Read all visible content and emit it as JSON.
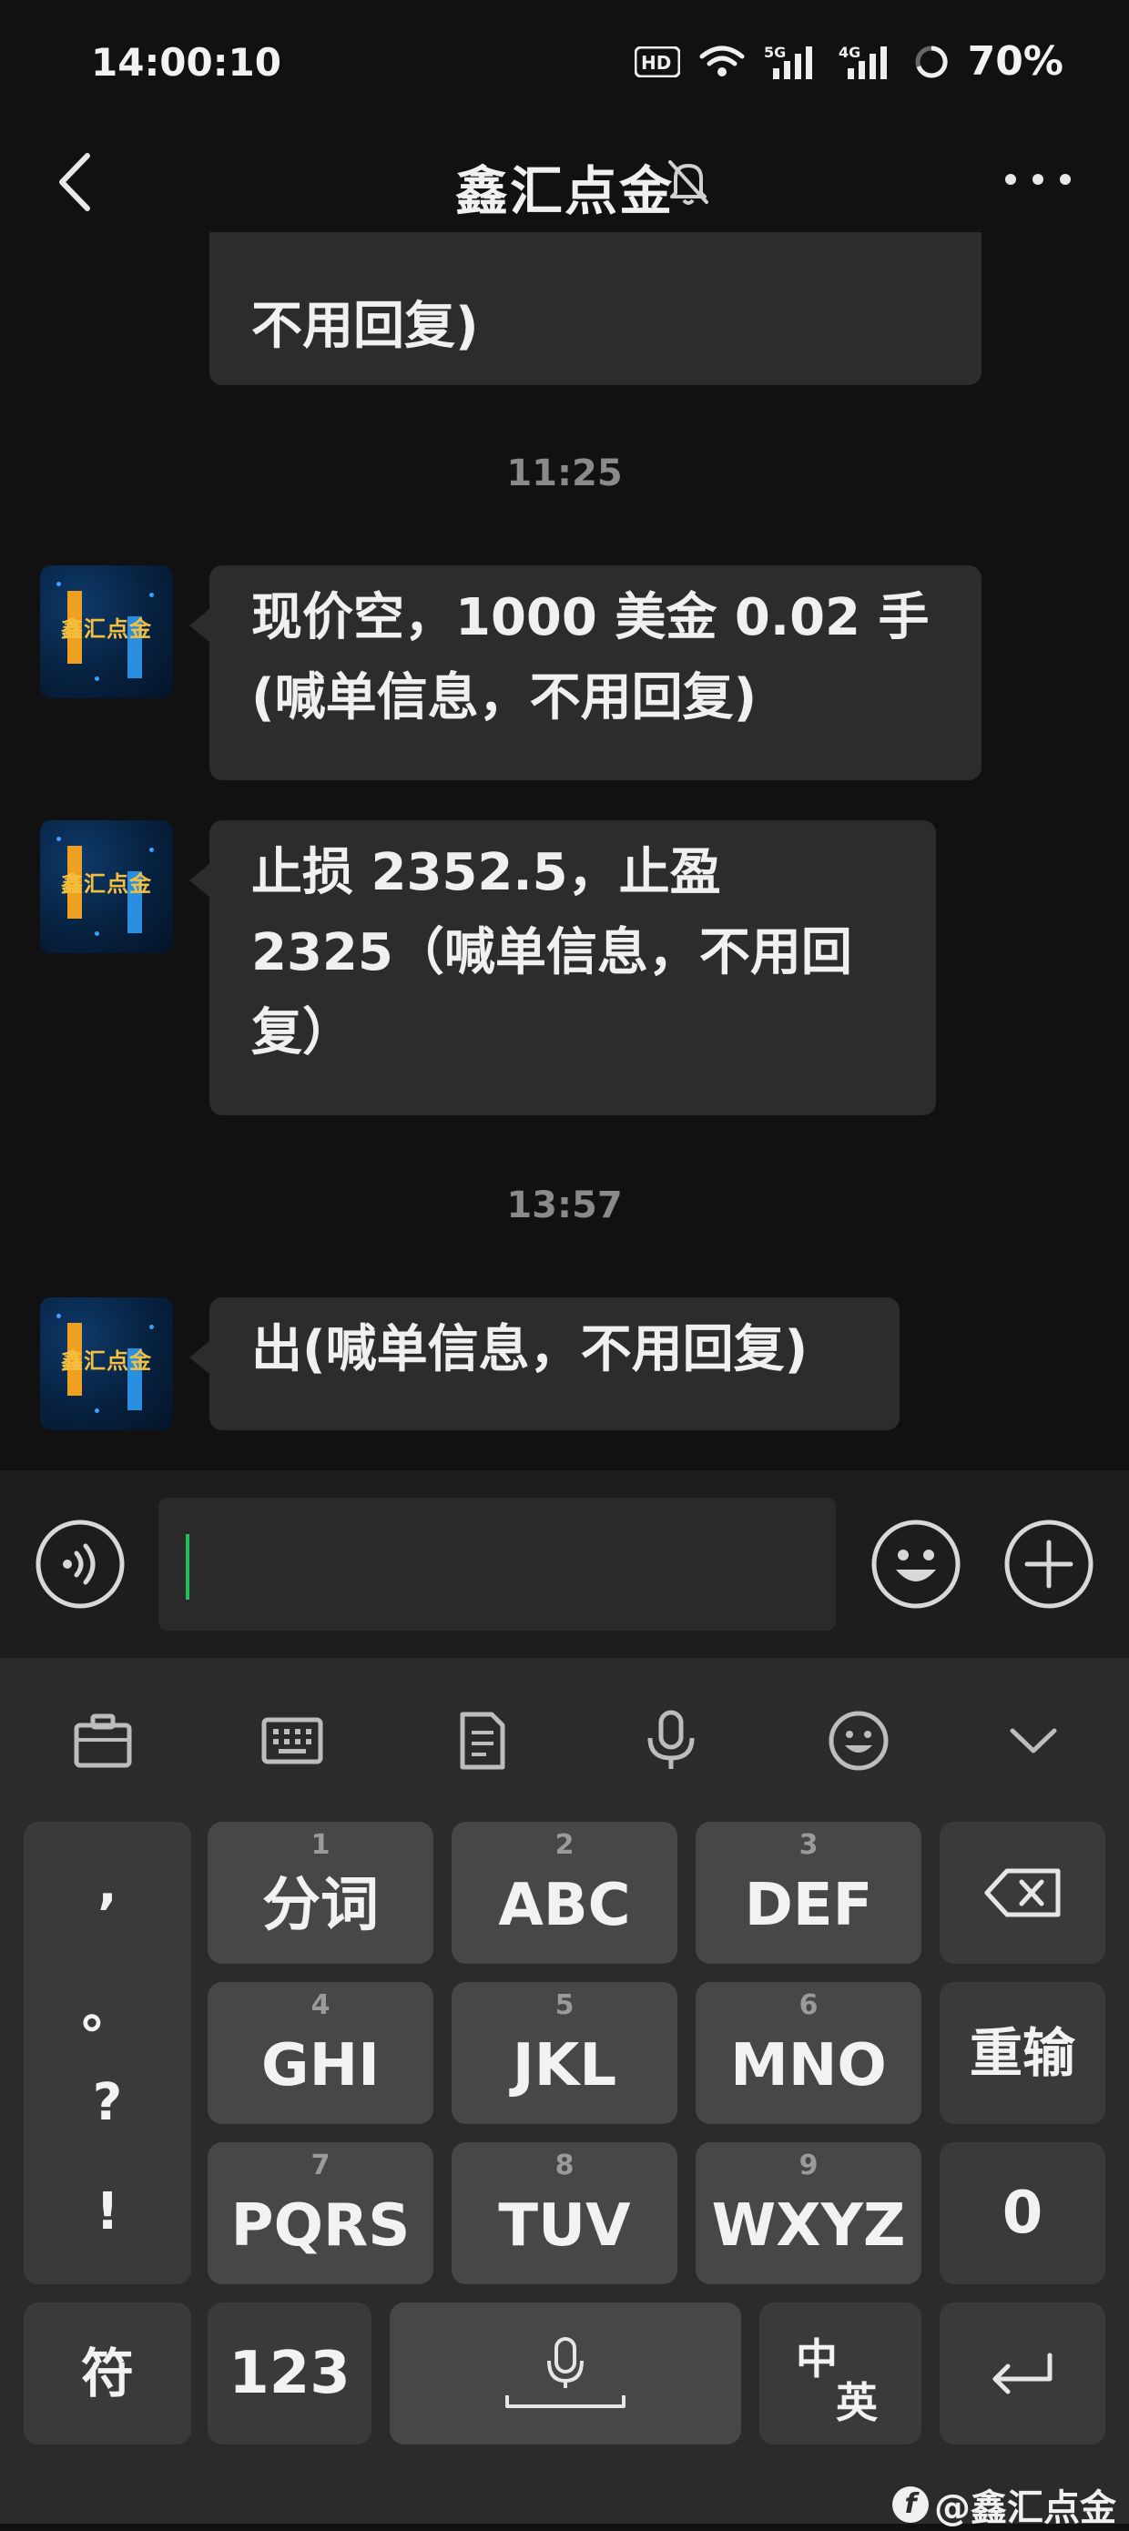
{
  "status_bar": {
    "time": "14:00:10",
    "network_icons": [
      "hd-icon",
      "wifi-icon",
      "5g-signal-icon",
      "4g-signal-icon"
    ],
    "net_labels": {
      "hd": "HD",
      "g5": "5G",
      "g4": "4G"
    },
    "battery": "70%"
  },
  "header": {
    "title": "鑫汇点金",
    "muted": true
  },
  "chat": {
    "messages": [
      {
        "text": "不用回复)"
      },
      {
        "timestamp": "11:25"
      },
      {
        "line1": "现价空，1000 美金 0.02 手",
        "line2": "(喊单信息，不用回复)"
      },
      {
        "line1": "止损 2352.5，止盈",
        "line2": "2325（喊单信息，不用回",
        "line3": "复）"
      },
      {
        "timestamp": "13:57"
      },
      {
        "text": "出(喊单信息，不用回复)"
      }
    ],
    "avatar_text": "鑫汇点金"
  },
  "input": {
    "value": ""
  },
  "keyboard": {
    "punct": [
      ",",
      "。",
      "?",
      "!"
    ],
    "keys": [
      {
        "num": "1",
        "label": "分词"
      },
      {
        "num": "2",
        "label": "ABC"
      },
      {
        "num": "3",
        "label": "DEF"
      },
      {
        "num": "4",
        "label": "GHI"
      },
      {
        "num": "5",
        "label": "JKL"
      },
      {
        "num": "6",
        "label": "MNO"
      },
      {
        "num": "7",
        "label": "PQRS"
      },
      {
        "num": "8",
        "label": "TUV"
      },
      {
        "num": "9",
        "label": "WXYZ"
      }
    ],
    "reinput": "重输",
    "zero": "0",
    "symbols": "符",
    "numbers": "123",
    "lang_top": "中",
    "lang_bottom": "英"
  },
  "watermark": "@鑫汇点金",
  "watermark_logo": "f",
  "colors": {
    "background": "#111111",
    "bubble": "#2c2c2c",
    "caret": "#1fbf5a",
    "key": "#474747"
  }
}
